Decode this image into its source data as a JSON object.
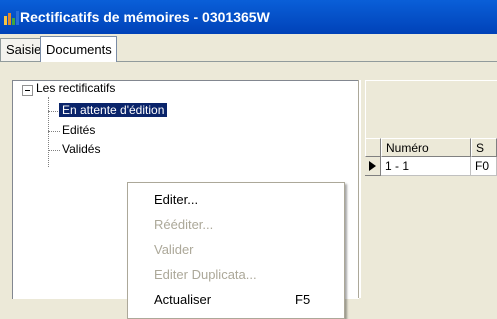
{
  "window": {
    "title": "Rectificatifs de mémoires - 0301365W",
    "accent": "#0a5fd8"
  },
  "tabs": [
    {
      "label": "Saisie",
      "active": false
    },
    {
      "label": "Documents",
      "active": true
    }
  ],
  "tree": {
    "root": "Les rectificatifs",
    "items": [
      {
        "label": "En attente d'édition",
        "selected": true
      },
      {
        "label": "Edités",
        "selected": false
      },
      {
        "label": "Validés",
        "selected": false
      }
    ]
  },
  "grid": {
    "columns": [
      "Numéro",
      "S"
    ],
    "rows": [
      {
        "numero": "1 - 1",
        "s": "F0"
      }
    ]
  },
  "context_menu": {
    "items": [
      {
        "label": "Editer...",
        "enabled": true,
        "shortcut": ""
      },
      {
        "label": "Rééditer...",
        "enabled": false,
        "shortcut": ""
      },
      {
        "label": "Valider",
        "enabled": false,
        "shortcut": ""
      },
      {
        "label": "Editer Duplicata...",
        "enabled": false,
        "shortcut": ""
      },
      {
        "label": "Actualiser",
        "enabled": true,
        "shortcut": "F5"
      }
    ]
  }
}
